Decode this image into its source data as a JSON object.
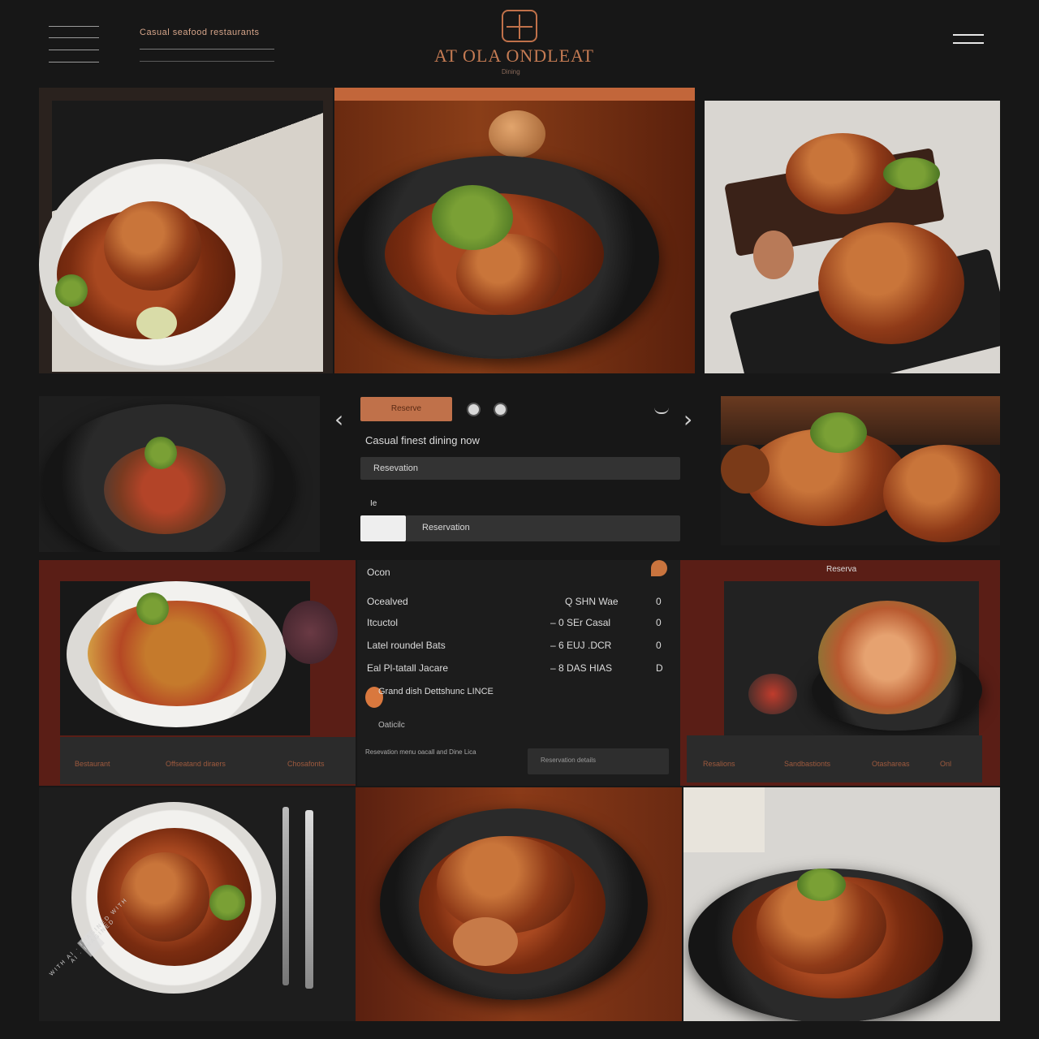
{
  "header": {
    "tagline": "Casual seafood restaurants",
    "brand": "AT OLA ONDLEAT",
    "brand_sub": "Dining"
  },
  "booking": {
    "tab_label": "Reserve",
    "heading": "Casual finest dining now",
    "field1_value": "Resevation",
    "field2_label": "Ie",
    "field2_value": "Reservation"
  },
  "menu": {
    "title": "Ocon",
    "items": [
      {
        "name": "Ocealved",
        "detail": "Q SHN  Wae",
        "price": "0"
      },
      {
        "name": "Itcuctol",
        "detail": "– 0  SEr Casal",
        "price": "0"
      },
      {
        "name": "Latel roundel Bats",
        "detail": "– 6  EUJ .DCR",
        "price": "0"
      },
      {
        "name": "Eal Pl-tatall Jacare",
        "detail": "– 8  DAS HIAS",
        "price": "D"
      }
    ],
    "highlight": "Grand dish Dettshunc LINCE",
    "sub": "Oaticilc",
    "footer_left": "Resevation menu oacall and Dine  Lica",
    "footer_right": "Reservation details"
  },
  "side_left": {
    "footer": [
      "Bestaurant",
      "Offseatand diraers",
      "Chosafonts"
    ]
  },
  "side_right": {
    "title": "Reserva",
    "footer": [
      "Resalions",
      "Sandbastionts",
      "Otashareas",
      "Onl"
    ]
  },
  "watermark": "WITH AI · IMAGINED WITH AI · IMAGINED"
}
